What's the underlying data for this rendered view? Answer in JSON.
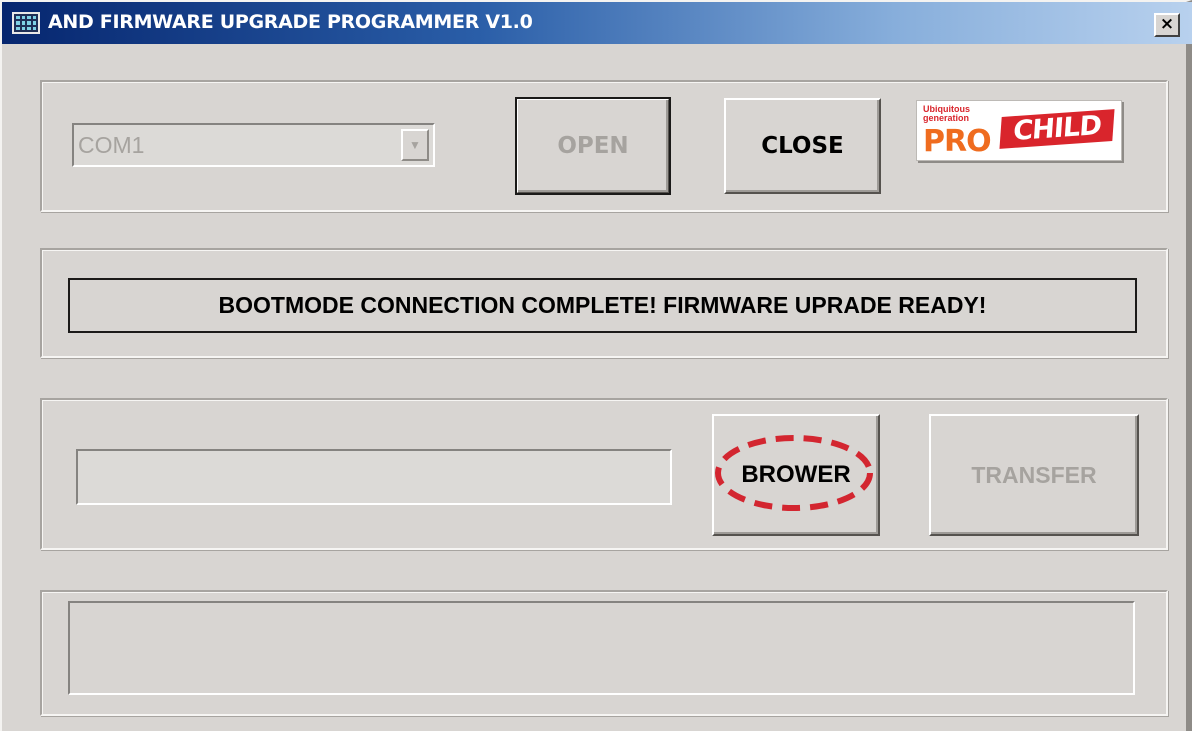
{
  "window": {
    "title": "AND FIRMWARE UPGRADE PROGRAMMER V1.0",
    "close_label": "×"
  },
  "port": {
    "selected": "COM1",
    "open_label": "OPEN",
    "close_label": "CLOSE"
  },
  "logo": {
    "tagline": "Ubiquitous generation",
    "pro": "PRO",
    "child": "CHILD"
  },
  "status": {
    "message": "BOOTMODE CONNECTION COMPLETE! FIRMWARE UPRADE READY!"
  },
  "file": {
    "path_value": "",
    "browse_label": "BROWER",
    "transfer_label": "TRANSFER"
  },
  "log": {
    "text": ""
  },
  "colors": {
    "face": "#d8d5d2",
    "disabled_text": "#a6a39f",
    "annotation": "#d32630",
    "title_start": "#06266f",
    "title_end": "#b8d1ee"
  },
  "icons": {
    "app": "app-grid-icon",
    "close": "close-icon",
    "dropdown": "chevron-down-icon"
  }
}
